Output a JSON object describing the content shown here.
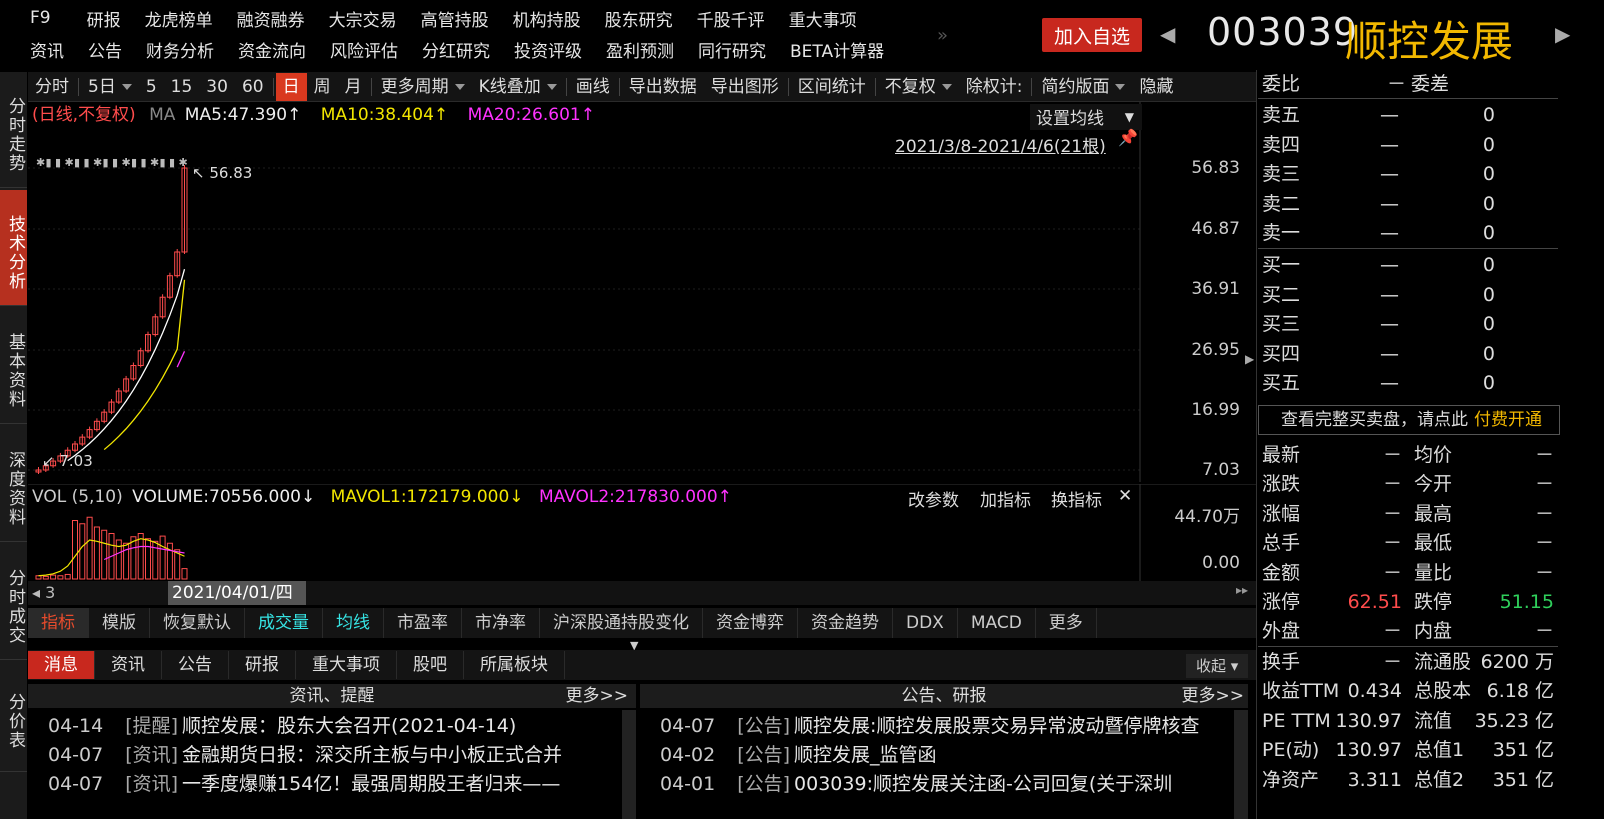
{
  "nav_row1": [
    "F9",
    "研报",
    "龙虎榜单",
    "融资融券",
    "大宗交易",
    "高管持股",
    "机构持股",
    "股东研究",
    "千股千评",
    "重大事项"
  ],
  "nav_row2": [
    "资讯",
    "公告",
    "财务分析",
    "资金流向",
    "风险评估",
    "分红研究",
    "投资评级",
    "盈利预测",
    "同行研究",
    "BETA计算器"
  ],
  "nav_more": "»",
  "add_watchlist": "加入自选",
  "stock": {
    "code": "003039",
    "name": "顺控发展"
  },
  "side_tabs": [
    "分时走势",
    "技术分析",
    "基本资料",
    "深度资料",
    "分时成交",
    "分价表"
  ],
  "toolbar": [
    "分时",
    "5日",
    "5",
    "15",
    "30",
    "60",
    "日",
    "周",
    "月",
    "更多周期",
    "K线叠加",
    "画线",
    "导出数据",
    "导出图形",
    "区间统计",
    "不复权",
    "除权计:",
    "简约版面",
    "隐藏"
  ],
  "ma_legend": {
    "type": "(日线,不复权)",
    "ma": "MA",
    "ma5": "MA5:47.390↑",
    "ma10": "MA10:38.404↑",
    "ma20": "MA20:26.601↑"
  },
  "ma_settings": "设置均线",
  "date_range": "2021/3/8-2021/4/6(21根)",
  "chart_data": {
    "type": "candlestick",
    "y_ticks": [
      "56.83",
      "46.87",
      "36.91",
      "26.95",
      "16.99",
      "7.03"
    ],
    "ylim": [
      7.03,
      56.83
    ],
    "high_label": "56.83",
    "low_label": "7.03",
    "candles": [
      7.03,
      7.73,
      8.5,
      9.35,
      10.29,
      11.32,
      12.45,
      13.69,
      15.06,
      16.57,
      18.23,
      20.05,
      22.05,
      24.26,
      26.69,
      29.36,
      32.29,
      35.52,
      39.07,
      42.98,
      56.83
    ],
    "ma5": [
      null,
      null,
      null,
      null,
      8.58,
      9.44,
      10.38,
      11.42,
      12.56,
      13.82,
      15.2,
      16.72,
      18.39,
      20.23,
      22.26,
      24.48,
      26.93,
      29.62,
      32.58,
      35.84,
      40.15
    ],
    "ma10": [
      null,
      null,
      null,
      null,
      null,
      null,
      null,
      null,
      null,
      10.4,
      11.43,
      12.58,
      13.83,
      15.22,
      16.74,
      18.41,
      20.25,
      22.28,
      24.5,
      26.95,
      38.4
    ],
    "ma20": [
      null,
      null,
      null,
      null,
      null,
      null,
      null,
      null,
      null,
      null,
      null,
      null,
      null,
      null,
      null,
      null,
      null,
      null,
      null,
      24.0,
      26.6
    ]
  },
  "vol_legend": {
    "label": "VOL (5,10)",
    "volume": "VOLUME:70556.000↓",
    "mavol1": "MAVOL1:172179.000↓",
    "mavol2": "MAVOL2:217830.000↑"
  },
  "vol_buttons": [
    "改参数",
    "加指标",
    "换指标",
    "✕"
  ],
  "vol_ticks": [
    "44.70万",
    "0.00"
  ],
  "volumes": [
    0.05,
    0.04,
    0.06,
    0.05,
    0.07,
    0.9,
    0.85,
    0.95,
    0.8,
    0.75,
    0.7,
    0.6,
    0.55,
    0.65,
    0.7,
    0.62,
    0.58,
    0.66,
    0.55,
    0.45,
    0.16
  ],
  "time_row": {
    "left": "◂ 3",
    "date": "2021/04/01/四",
    "right": "▸▸"
  },
  "indicator_tabs": [
    "指标",
    "模版",
    "恢复默认",
    "成交量",
    "均线",
    "市盈率",
    "市净率",
    "沪深股通持股变化",
    "资金博弈",
    "资金趋势",
    "DDX",
    "MACD",
    "更多"
  ],
  "news_tabs": [
    "消息",
    "资讯",
    "公告",
    "研报",
    "重大事项",
    "股吧",
    "所属板块"
  ],
  "collapse": "收起 ▾",
  "left_panel": {
    "title": "资讯、提醒",
    "more": "更多>>",
    "rows": [
      {
        "date": "04-14",
        "type": "[提醒]",
        "text": "顺控发展：股东大会召开(2021-04-14)"
      },
      {
        "date": "04-07",
        "type": "[资讯]",
        "text": "金融期货日报：深交所主板与中小板正式合并"
      },
      {
        "date": "04-07",
        "type": "[资讯]",
        "text": "一季度爆赚154亿！最强周期股王者归来——"
      }
    ]
  },
  "right_news_panel": {
    "title": "公告、研报",
    "more": "更多>>",
    "rows": [
      {
        "date": "04-07",
        "type": "[公告]",
        "text": "顺控发展:顺控发展股票交易异常波动暨停牌核查"
      },
      {
        "date": "04-02",
        "type": "[公告]",
        "text": "顺控发展_监管函"
      },
      {
        "date": "04-01",
        "type": "[公告]",
        "text": "003039:顺控发展关注函-公司回复(关于深圳"
      }
    ]
  },
  "order_book": {
    "header": {
      "wb": "委比",
      "wb_val": "－",
      "wc": "委差"
    },
    "sells": [
      {
        "l": "卖五",
        "p": "—",
        "v": "0"
      },
      {
        "l": "卖四",
        "p": "—",
        "v": "0"
      },
      {
        "l": "卖三",
        "p": "—",
        "v": "0"
      },
      {
        "l": "卖二",
        "p": "—",
        "v": "0"
      },
      {
        "l": "卖一",
        "p": "—",
        "v": "0"
      }
    ],
    "buys": [
      {
        "l": "买一",
        "p": "—",
        "v": "0"
      },
      {
        "l": "买二",
        "p": "—",
        "v": "0"
      },
      {
        "l": "买三",
        "p": "—",
        "v": "0"
      },
      {
        "l": "买四",
        "p": "—",
        "v": "0"
      },
      {
        "l": "买五",
        "p": "—",
        "v": "0"
      }
    ],
    "notice": "查看完整买卖盘，请点此",
    "notice_link": "付费开通"
  },
  "quote": [
    {
      "l1": "最新",
      "v1": "－",
      "l2": "均价",
      "v2": "－"
    },
    {
      "l1": "涨跌",
      "v1": "－",
      "l2": "今开",
      "v2": "－"
    },
    {
      "l1": "涨幅",
      "v1": "－",
      "l2": "最高",
      "v2": "－"
    },
    {
      "l1": "总手",
      "v1": "－",
      "l2": "最低",
      "v2": "－"
    },
    {
      "l1": "金额",
      "v1": "－",
      "l2": "量比",
      "v2": "－"
    },
    {
      "l1": "涨停",
      "v1": "62.51",
      "l2": "跌停",
      "v2": "51.15"
    },
    {
      "l1": "外盘",
      "v1": "－",
      "l2": "内盘",
      "v2": "－"
    }
  ],
  "fundamentals": [
    {
      "l1": "换手",
      "v1": "－",
      "l2": "流通股",
      "v2": "6200 万"
    },
    {
      "l1": "收益TTM",
      "v1": "0.434",
      "l2": "总股本",
      "v2": "6.18 亿"
    },
    {
      "l1": "PE TTM",
      "v1": "130.97",
      "l2": "流值",
      "v2": "35.23 亿"
    },
    {
      "l1": "PE(动)",
      "v1": "130.97",
      "l2": "总值1",
      "v2": "351 亿"
    },
    {
      "l1": "净资产",
      "v1": "3.311",
      "l2": "总值2",
      "v2": "351 亿"
    }
  ]
}
